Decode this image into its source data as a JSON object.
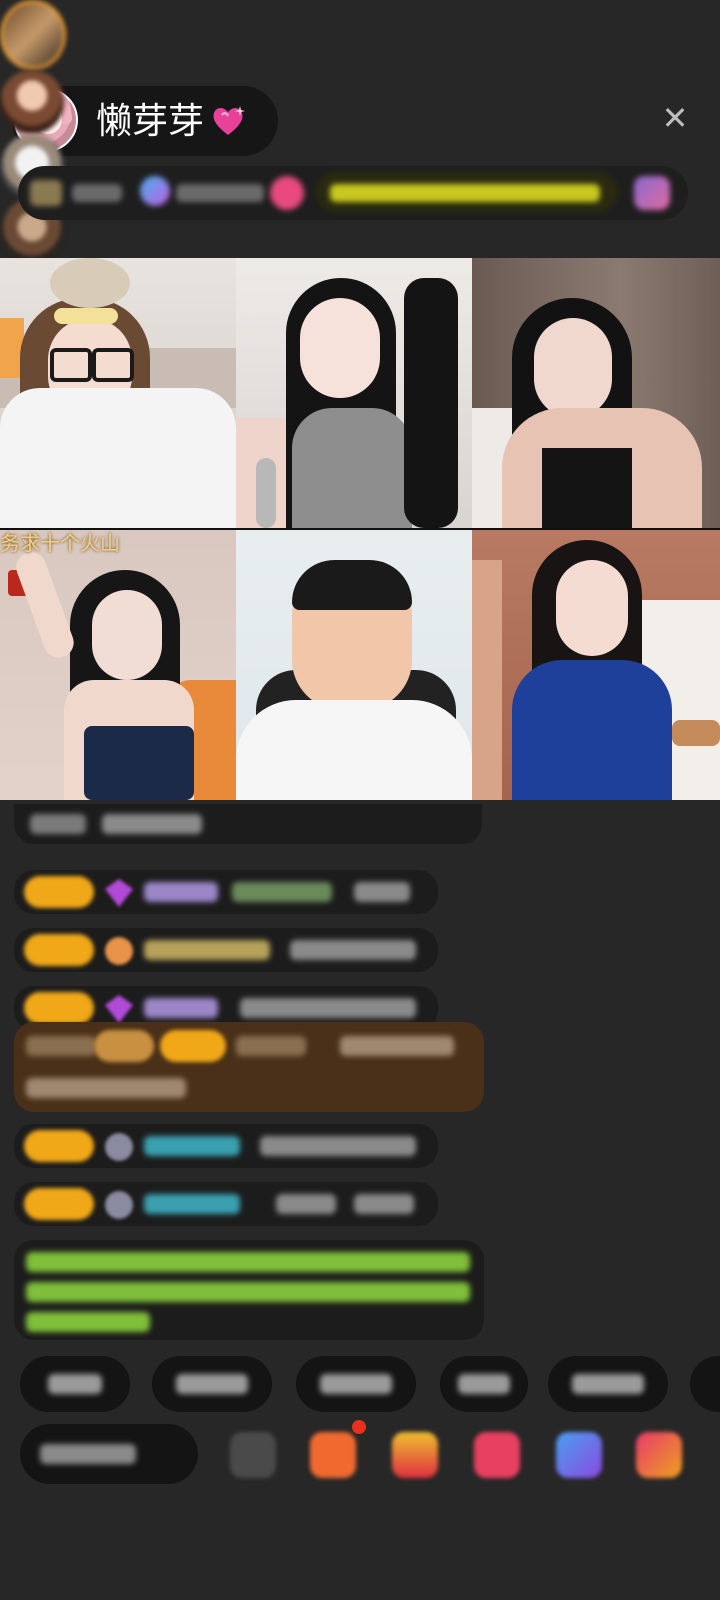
{
  "header": {
    "host_name": "懒芽芽",
    "heart_emoji": "💖",
    "close_label": "✕"
  },
  "video_grid": {
    "caption": "务求十个火山"
  },
  "icons": {
    "heart": "sparkling-heart-icon",
    "close": "close-icon"
  },
  "colors": {
    "background": "#272727",
    "badge": "#f0a818",
    "chat_bubble": "#1c1c1c",
    "system_message_bg": "#4a3018",
    "system_text": "#7fbf3a"
  }
}
